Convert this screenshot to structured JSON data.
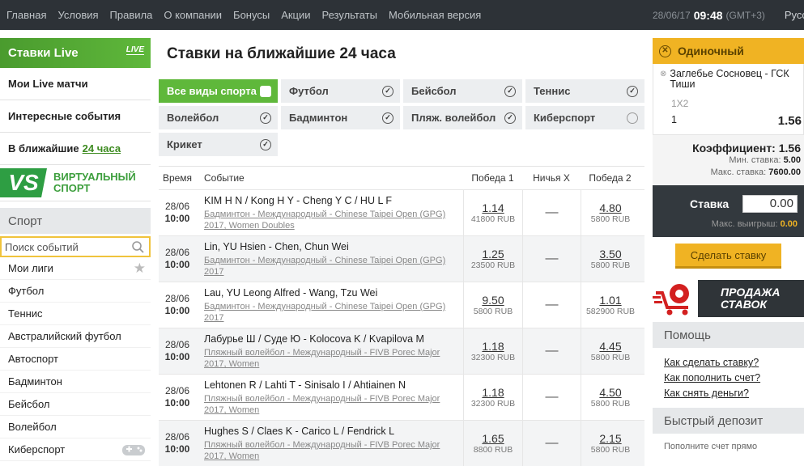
{
  "topbar": {
    "nav": [
      "Главная",
      "Условия",
      "Правила",
      "О компании",
      "Бонусы",
      "Акции",
      "Результаты",
      "Мобильная версия"
    ],
    "date": "28/06/17",
    "time": "09:48",
    "tz": "(GMT+3)",
    "language": "Русский"
  },
  "left": {
    "live_title": "Ставки Live",
    "live_badge": "LIVE",
    "menu": [
      "Мои Live матчи",
      "Интересные события"
    ],
    "near_prefix": "В ближайшие",
    "near_link": "24 часа",
    "vs_logo": "VS",
    "virtual_line1": "ВИРТУАЛЬНЫЙ",
    "virtual_line2": "СПОРТ",
    "sport_title": "Спорт",
    "search_placeholder": "Поиск событий",
    "sports": [
      "Мои лиги",
      "Футбол",
      "Теннис",
      "Австралийский футбол",
      "Автоспорт",
      "Бадминтон",
      "Бейсбол",
      "Волейбол",
      "Киберспорт"
    ]
  },
  "main": {
    "title": "Ставки на ближайшие 24 часа",
    "filters": [
      {
        "label": "Все виды спорта",
        "checked": true,
        "active": true
      },
      {
        "label": "Футбол",
        "checked": true
      },
      {
        "label": "Бейсбол",
        "checked": true
      },
      {
        "label": "Теннис",
        "checked": true
      },
      {
        "label": "Волейбол",
        "checked": true
      },
      {
        "label": "Бадминтон",
        "checked": true
      },
      {
        "label": "Пляж. волейбол",
        "checked": true
      },
      {
        "label": "Киберспорт",
        "checked": false
      },
      {
        "label": "Крикет",
        "checked": true
      }
    ],
    "columns": {
      "time": "Время",
      "event": "Событие",
      "win1": "Победа 1",
      "draw": "Ничья X",
      "win2": "Победа 2"
    },
    "draw_placeholder": "—",
    "rows": [
      {
        "date": "28/06",
        "time": "10:00",
        "name": "KIM H N / Kong H Y - Cheng Y C / HU L F",
        "league": "Бадминтон - Международный - Chinese Taipei Open (GPG) 2017, Women Doubles",
        "o1": "1.14",
        "v1": "41800 RUB",
        "o2": "4.80",
        "v2": "5800 RUB"
      },
      {
        "date": "28/06",
        "time": "10:00",
        "name": "Lin, YU Hsien - Chen, Chun Wei",
        "league": "Бадминтон - Международный - Chinese Taipei Open (GPG) 2017",
        "o1": "1.25",
        "v1": "23500 RUB",
        "o2": "3.50",
        "v2": "5800 RUB"
      },
      {
        "date": "28/06",
        "time": "10:00",
        "name": "Lau, YU Leong Alfred - Wang, Tzu Wei",
        "league": "Бадминтон - Международный - Chinese Taipei Open (GPG) 2017",
        "o1": "9.50",
        "v1": "5800 RUB",
        "o2": "1.01",
        "v2": "582900 RUB"
      },
      {
        "date": "28/06",
        "time": "10:00",
        "name": "Лабурье Ш / Суде Ю - Kolocova K / Kvapilova M",
        "league": "Пляжный волейбол - Международный - FIVB Porec Major 2017, Women",
        "o1": "1.18",
        "v1": "32300 RUB",
        "o2": "4.45",
        "v2": "5800 RUB"
      },
      {
        "date": "28/06",
        "time": "10:00",
        "name": "Lehtonen R / Lahti T - Sinisalo I / Ahtiainen N",
        "league": "Пляжный волейбол - Международный - FIVB Porec Major 2017, Women",
        "o1": "1.18",
        "v1": "32300 RUB",
        "o2": "4.50",
        "v2": "5800 RUB"
      },
      {
        "date": "28/06",
        "time": "10:00",
        "name": "Hughes S / Claes K - Carico L / Fendrick L",
        "league": "Пляжный волейбол - Международный - FIVB Porec Major 2017, Women",
        "o1": "1.65",
        "v1": "8800 RUB",
        "o2": "2.15",
        "v2": "5800 RUB"
      }
    ]
  },
  "slip": {
    "title": "Одиночный",
    "event": "Заглебье Сосновец - ГСК Тиши",
    "market": "1X2",
    "selection": "1",
    "selection_odd": "1.56",
    "coef_label": "Коэффициент: 1.56",
    "min_stake": "Мин. ставка:",
    "min_stake_val": "5.00",
    "max_stake": "Макс. ставка:",
    "max_stake_val": "7600.00",
    "stake_label": "Ставка",
    "stake_value": "0.00",
    "max_win": "Макс. выигрыш:",
    "max_win_val": "0.00",
    "button": "Сделать ставку"
  },
  "promo": {
    "line1": "ПРОДАЖА",
    "line2": "СТАВОК"
  },
  "help": {
    "title": "Помощь",
    "links": [
      "Как сделать ставку?",
      "Как пополнить счет?",
      "Как снять деньги?"
    ]
  },
  "deposit": {
    "title": "Быстрый депозит",
    "subtitle": "Пополните счет прямо"
  },
  "colors": {
    "green": "#5fb83b",
    "yellow": "#f0b323",
    "dark": "#2d3237"
  }
}
